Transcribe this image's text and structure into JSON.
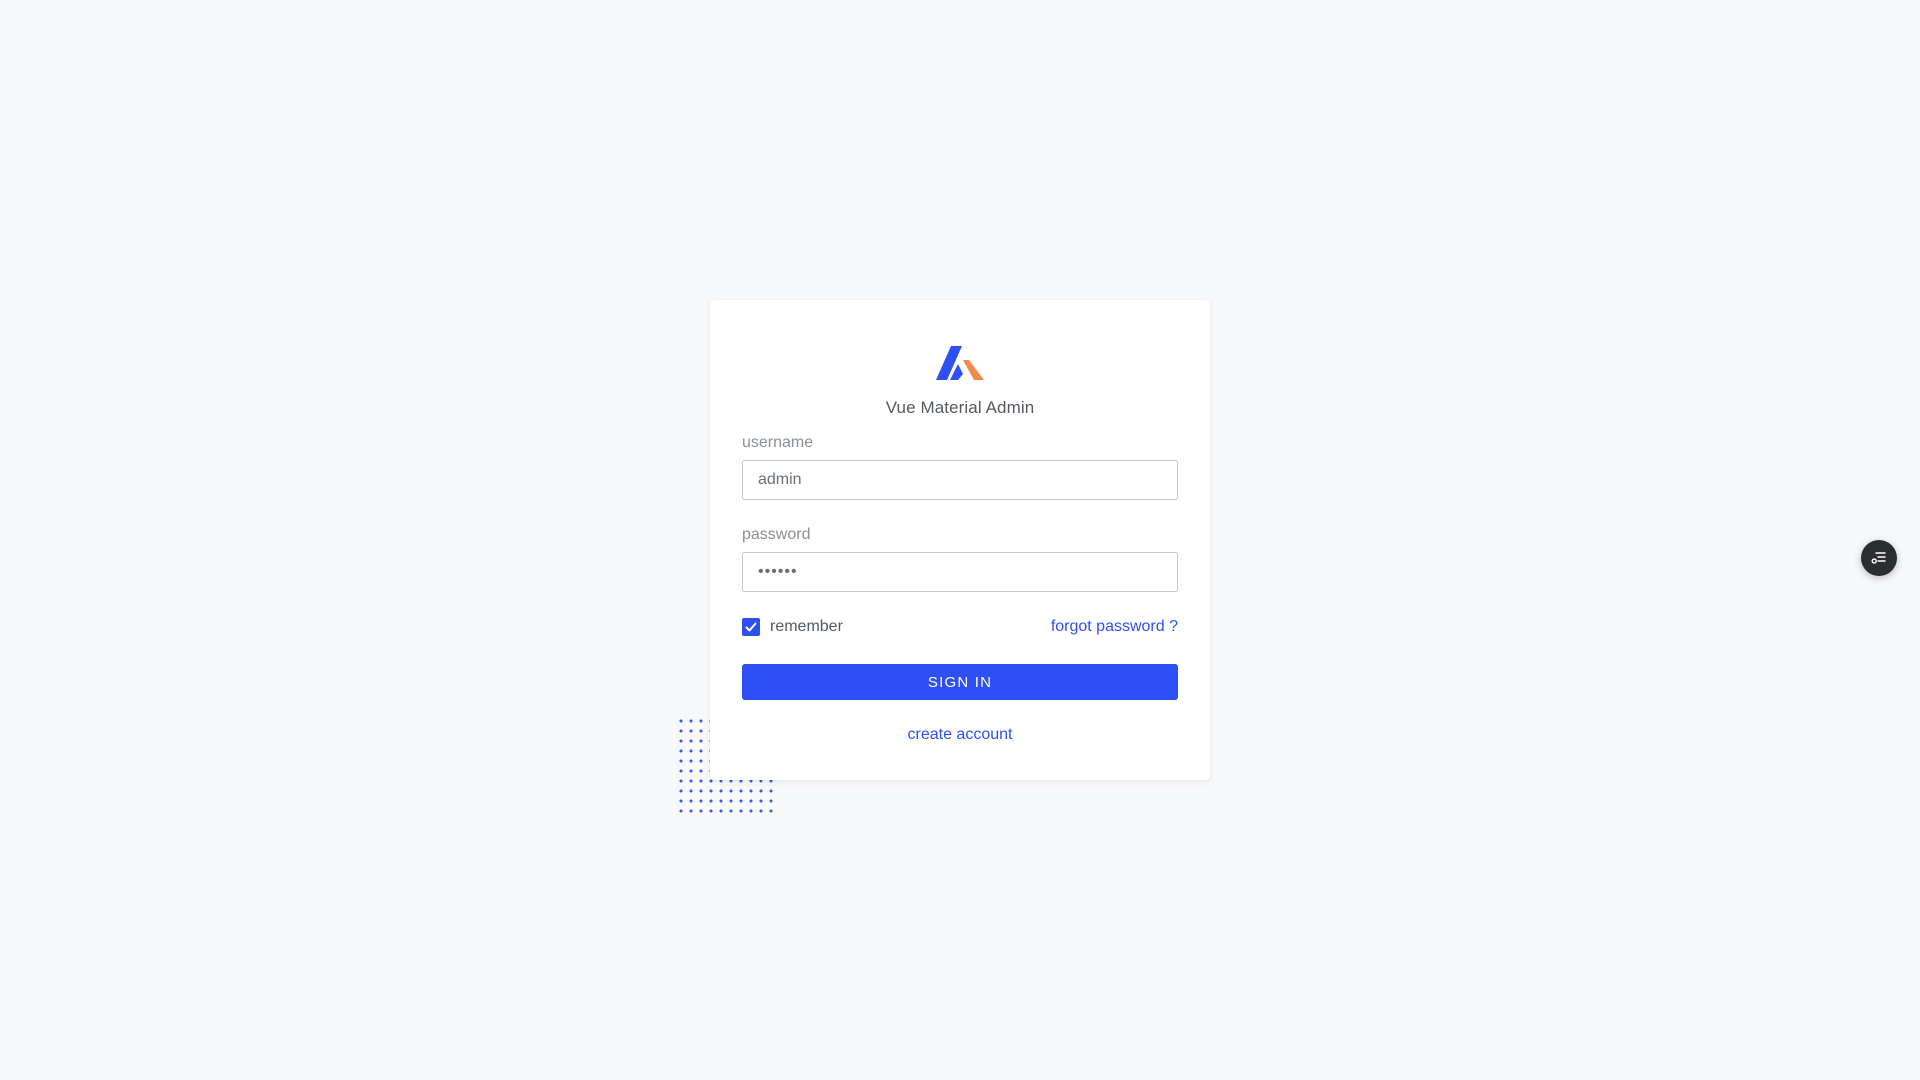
{
  "app": {
    "title": "Vue Material Admin"
  },
  "form": {
    "username_label": "username",
    "username_value": "admin",
    "password_label": "password",
    "password_value": "••••••",
    "remember_label": "remember",
    "remember_checked": true,
    "forgot_label": "forgot password ?",
    "signin_label": "SIGN IN",
    "create_label": "create account"
  },
  "icons": {
    "logo": "vue-material-admin-logo",
    "checkbox": "check-icon",
    "floating": "settings-list-icon"
  },
  "colors": {
    "primary": "#2f4ff6",
    "accent": "#f28a4b",
    "background": "#f8f9fa",
    "floating_button": "#2b2d31"
  }
}
